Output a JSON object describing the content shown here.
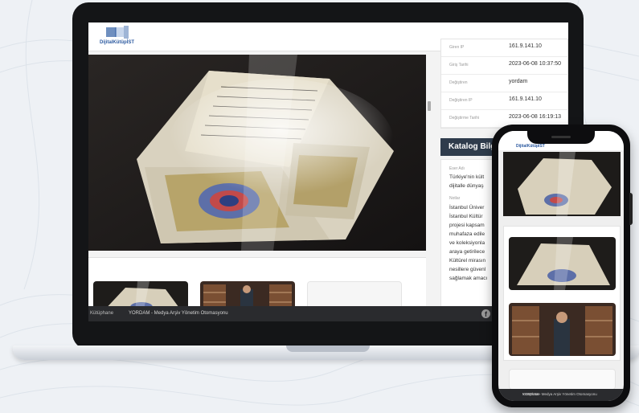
{
  "brand": {
    "logo_text": "DijitalKütüpİST",
    "accent_color": "#2c5aa0"
  },
  "record_info": [
    {
      "key": "Giren IP",
      "value": "161.9.141.10"
    },
    {
      "key": "Giriş Tarihi",
      "value": "2023-06-08 10:37:50"
    },
    {
      "key": "Değiştiren",
      "value": "yordam"
    },
    {
      "key": "Değiştiren IP",
      "value": "161.9.141.10"
    },
    {
      "key": "Değiştirme Tarihi",
      "value": "2023-06-08 16:19:13"
    }
  ],
  "catalog": {
    "title": "Katalog Bilgil",
    "eser_adi_label": "Eser Adı",
    "eser_adi_lines": [
      "Türkiye'nin kült",
      "dijitalle dünyaş"
    ],
    "notlar_label": "Notlar",
    "notlar_lines": [
      "İstanbul Üniver",
      "İstanbul Kültür",
      "projesi kapsam",
      "muhafaza edile",
      "ve koleksiyonla",
      "araya getirilece",
      "Kültürel mirasın",
      "nesillere güvenl",
      "sağlamak amacı"
    ]
  },
  "footer": {
    "left_text": "Kütüphane",
    "org_text": "YORDAM - Medya Arşiv Yönetim Otomasyonu",
    "social_icon": "facebook-icon"
  },
  "phone": {
    "logo_text": "DijitalKütüpİST",
    "footer_left": "Kütüphane",
    "footer_text": "YORDAM - Medya Arşiv Yönetim Otomasyonu"
  }
}
